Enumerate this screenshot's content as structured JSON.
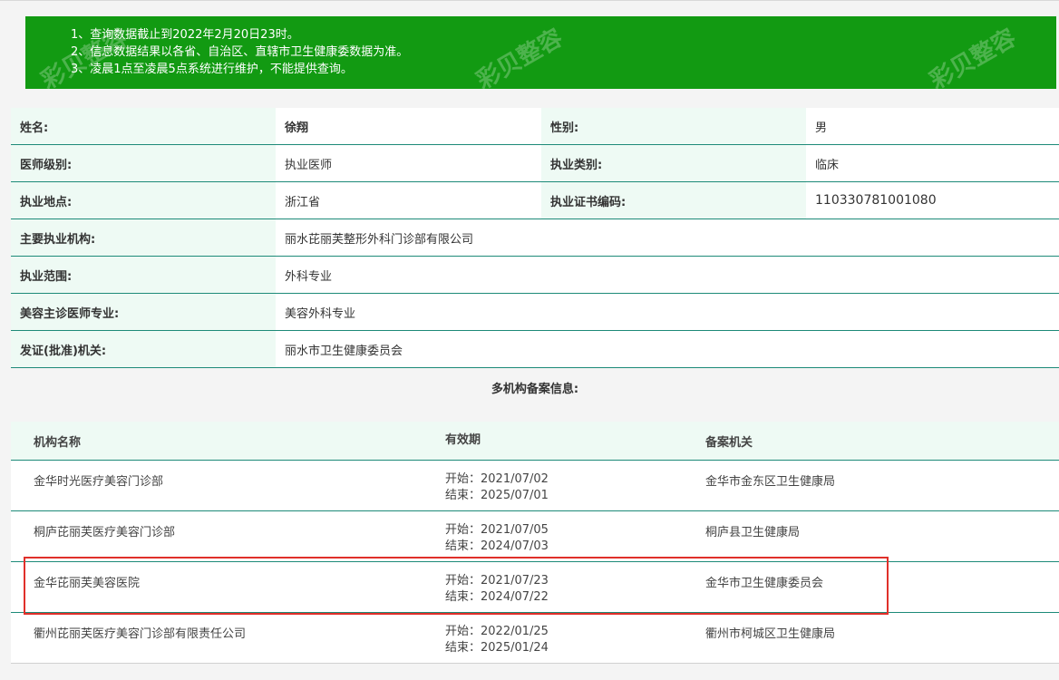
{
  "notice": {
    "lines": [
      "1、查询数据截止到2022年2月20日23时。",
      "2、信息数据结果以各省、自治区、直辖市卫生健康委数据为准。",
      "3、凌晨1点至凌晨5点系统进行维护，不能提供查询。"
    ],
    "background_color": "#129a12"
  },
  "watermark": {
    "text": "彩贝整容"
  },
  "profile": {
    "name_label": "姓名:",
    "name_value": "徐翔",
    "gender_label": "性别:",
    "gender_value": "男",
    "level_label": "医师级别:",
    "level_value": "执业医师",
    "category_label": "执业类别:",
    "category_value": "临床",
    "location_label": "执业地点:",
    "location_value": "浙江省",
    "cert_label": "执业证书编码:",
    "cert_value": "110330781001080",
    "main_org_label": "主要执业机构:",
    "main_org_value": "丽水芘丽芙整形外科门诊部有限公司",
    "scope_label": "执业范围:",
    "scope_value": "外科专业",
    "cosmetic_label": "美容主诊医师专业:",
    "cosmetic_value": "美容外科专业",
    "issuer_label": "发证(批准)机关:",
    "issuer_value": "丽水市卫生健康委员会"
  },
  "multi_org": {
    "title": "多机构备案信息:",
    "headers": {
      "name": "机构名称",
      "validity": "有效期",
      "agency": "备案机关"
    },
    "rows": [
      {
        "name": "金华时光医疗美容门诊部",
        "start": "开始：2021/07/02",
        "end": "结束：2025/07/01",
        "agency": "金华市金东区卫生健康局"
      },
      {
        "name": "桐庐芘丽芙医疗美容门诊部",
        "start": "开始：2021/07/05",
        "end": "结束：2024/07/03",
        "agency": "桐庐县卫生健康局"
      },
      {
        "name": "金华芘丽芙美容医院",
        "start": "开始：2021/07/23",
        "end": "结束：2024/07/22",
        "agency": "金华市卫生健康委员会"
      },
      {
        "name": "衢州芘丽芙医疗美容门诊部有限责任公司",
        "start": "开始：2022/01/25",
        "end": "结束：2025/01/24",
        "agency": "衢州市柯城区卫生健康局"
      }
    ],
    "highlight_color": "#e0302a"
  }
}
